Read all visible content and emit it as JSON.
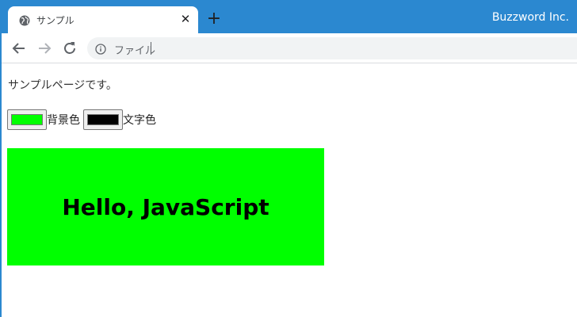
{
  "browser": {
    "tab_title": "サンプル",
    "close_glyph": "✕",
    "new_tab_glyph": "+",
    "brand": "Buzzword Inc.",
    "address_text": "ファイル",
    "accent_color": "#2b88d0"
  },
  "icons": {
    "tab_favicon": "globe-icon",
    "back": "back-arrow-icon",
    "forward": "forward-arrow-icon",
    "reload": "reload-icon",
    "info": "info-icon"
  },
  "page": {
    "intro": "サンプルページです。",
    "background_label": "背景色",
    "background_color": "#00ff00",
    "text_label": "文字色",
    "text_color": "#000000",
    "hello": "Hello, JavaScript"
  }
}
